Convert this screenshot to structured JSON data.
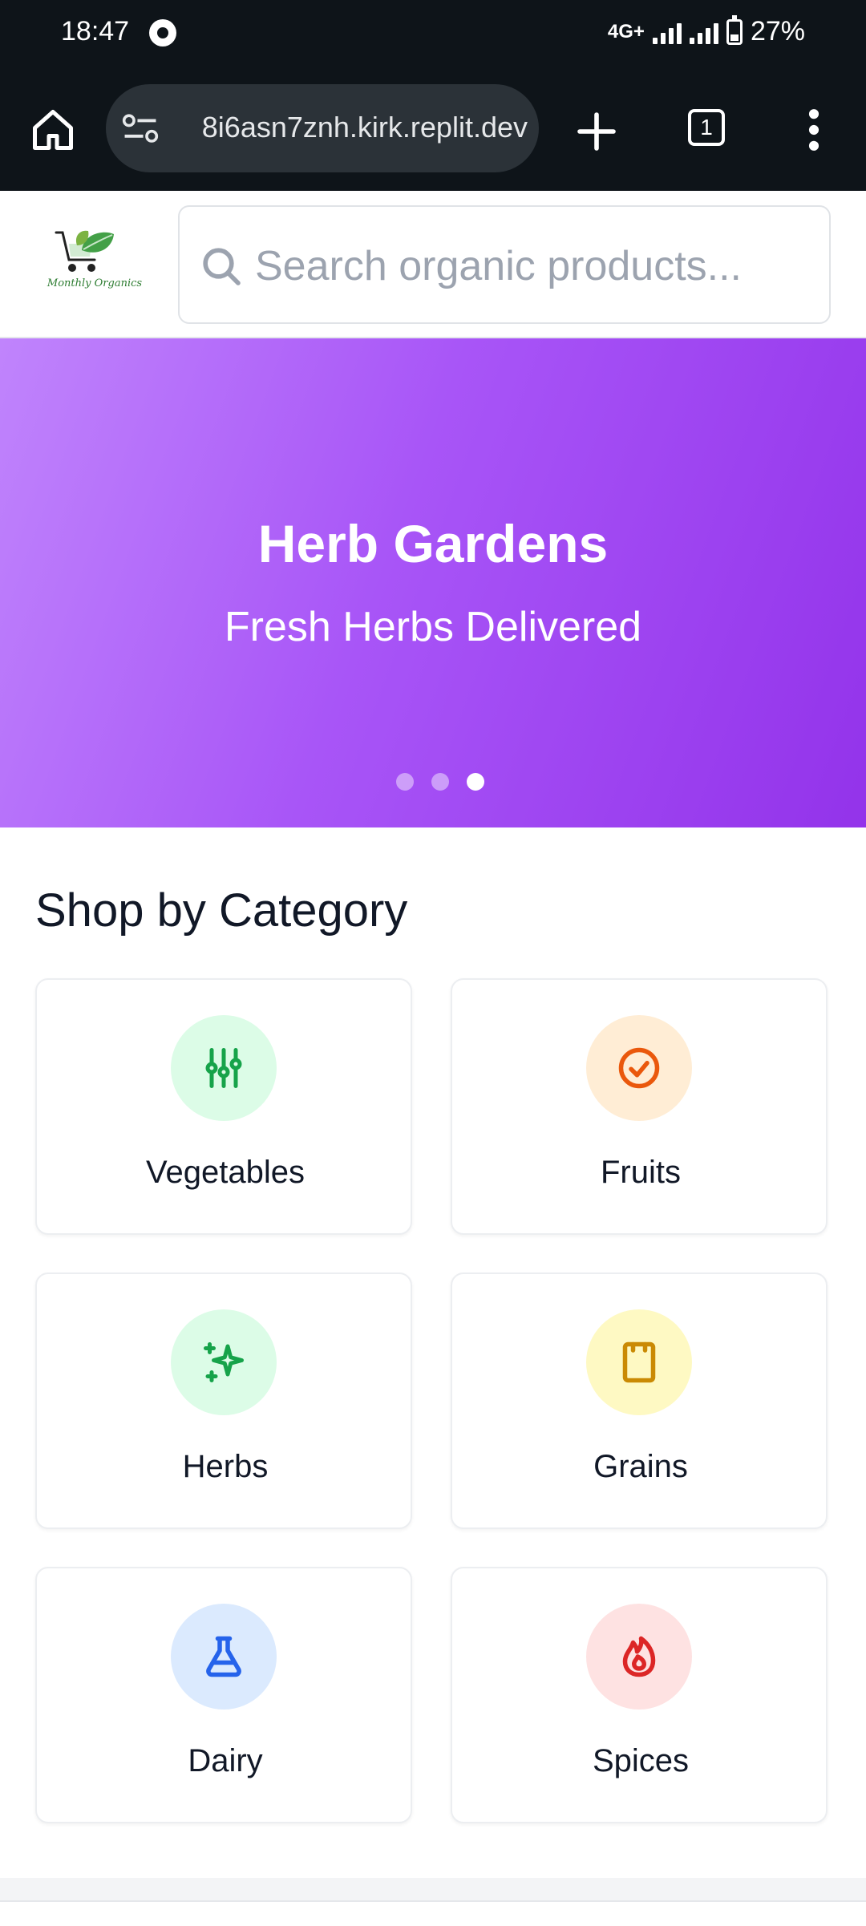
{
  "status_bar": {
    "time": "18:47",
    "network": "4G+",
    "battery": "27%"
  },
  "browser": {
    "url": "8i6asn7znh.kirk.replit.dev",
    "tab_count": "1"
  },
  "header": {
    "logo_text": "Monthly Organics",
    "search_placeholder": "Search organic products..."
  },
  "hero": {
    "title": "Herb Gardens",
    "subtitle": "Fresh Herbs Delivered",
    "slide_count": 3,
    "active_slide": 3
  },
  "categories": {
    "title": "Shop by Category",
    "items": [
      {
        "label": "Vegetables",
        "icon": "sliders-icon",
        "bg": "#dcfce7",
        "color": "#16a34a"
      },
      {
        "label": "Fruits",
        "icon": "check-circle-icon",
        "bg": "#ffedd5",
        "color": "#ea580c"
      },
      {
        "label": "Herbs",
        "icon": "sparkles-icon",
        "bg": "#dcfce7",
        "color": "#16a34a"
      },
      {
        "label": "Grains",
        "icon": "notepad-icon",
        "bg": "#fef9c3",
        "color": "#ca8a04"
      },
      {
        "label": "Dairy",
        "icon": "flask-icon",
        "bg": "#dbeafe",
        "color": "#2563eb"
      },
      {
        "label": "Spices",
        "icon": "flame-icon",
        "bg": "#fee2e2",
        "color": "#dc2626"
      }
    ]
  }
}
